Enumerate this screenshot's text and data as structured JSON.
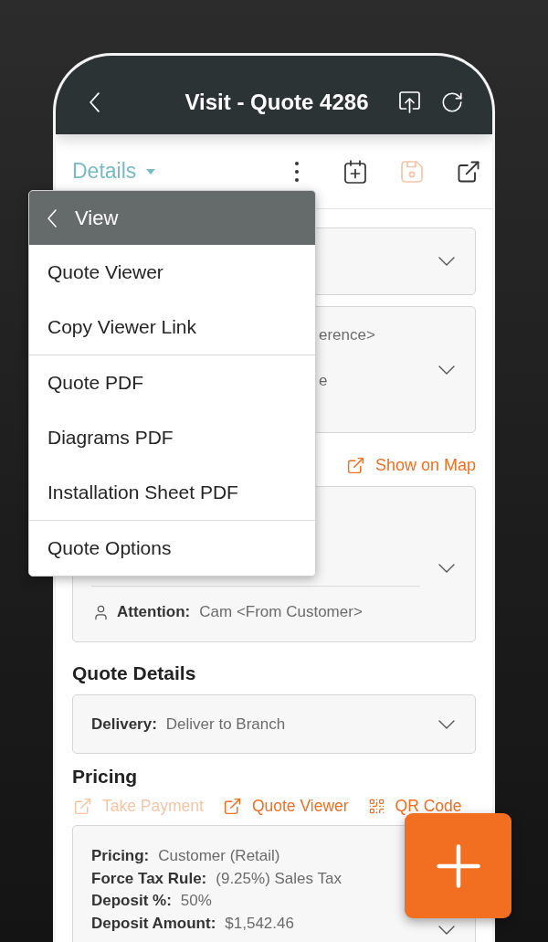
{
  "header": {
    "title": "Visit - Quote 4286"
  },
  "toolbar": {
    "section": "Details",
    "save_disabled": true
  },
  "view_menu": {
    "title": "View",
    "sections": [
      {
        "items": [
          "Quote Viewer",
          "Copy Viewer Link"
        ]
      },
      {
        "items": [
          "Quote PDF",
          "Diagrams PDF",
          "Installation Sheet PDF"
        ]
      },
      {
        "items": [
          "Quote Options"
        ]
      }
    ]
  },
  "reference_card": {
    "lines": [
      "erence>",
      "e"
    ]
  },
  "map_link": "Show on Map",
  "address_card": {
    "attention": {
      "label": "Attention:",
      "value": "Cam <From Customer>"
    }
  },
  "quote_details": {
    "heading": "Quote Details",
    "fields": [
      {
        "label": "Delivery:",
        "value": "Deliver to Branch"
      }
    ]
  },
  "pricing": {
    "heading": "Pricing",
    "actions": [
      {
        "kind": "link",
        "label": "Take Payment",
        "disabled": true
      },
      {
        "kind": "link",
        "label": "Quote Viewer",
        "disabled": false
      },
      {
        "kind": "qr",
        "label": "QR Code",
        "disabled": false
      }
    ],
    "fields": [
      {
        "label": "Pricing:",
        "value": "Customer (Retail)"
      },
      {
        "label": "Force Tax Rule:",
        "value": "(9.25%) Sales Tax"
      },
      {
        "label": "Deposit %:",
        "value": "50%"
      },
      {
        "label": "Deposit Amount:",
        "value": "$1,542.46"
      }
    ]
  }
}
